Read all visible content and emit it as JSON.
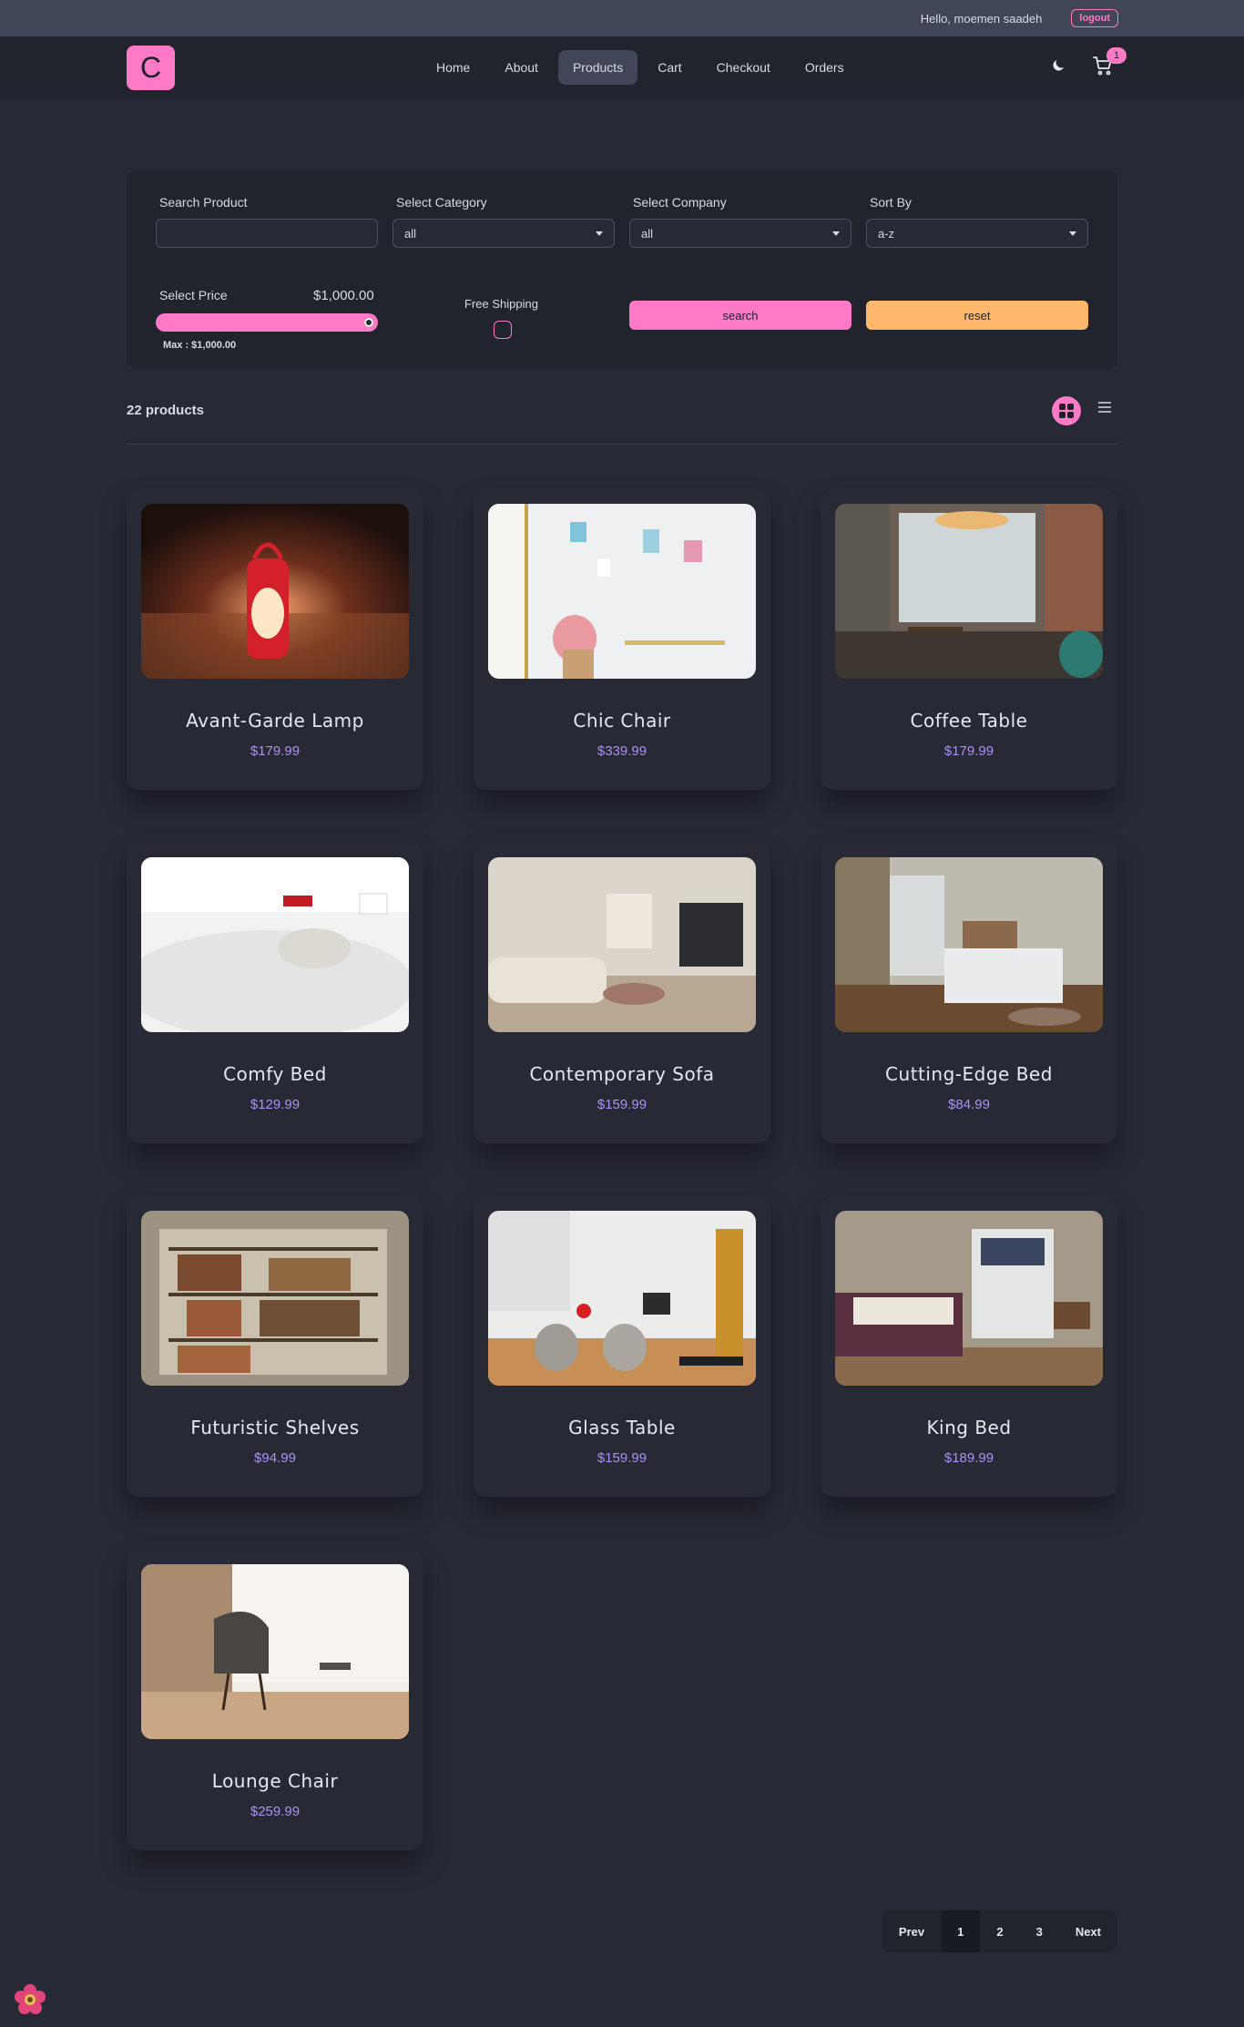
{
  "topbar": {
    "greeting": "Hello, moemen saadeh",
    "logout": "logout"
  },
  "nav": {
    "logo": "C",
    "links": [
      "Home",
      "About",
      "Products",
      "Cart",
      "Checkout",
      "Orders"
    ],
    "active": "Products",
    "cart_count": "1"
  },
  "filters": {
    "search_label": "Search Product",
    "search_value": "",
    "category_label": "Select Category",
    "category_value": "all",
    "company_label": "Select Company",
    "company_value": "all",
    "sort_label": "Sort By",
    "sort_value": "a-z",
    "price_label": "Select Price",
    "price_value": "$1,000.00",
    "price_max": "Max : $1,000.00",
    "price_level": 1.0,
    "shipping_label": "Free Shipping",
    "search_button": "search",
    "reset_button": "reset"
  },
  "results": {
    "count": "22 products"
  },
  "products": [
    {
      "title": "Avant-Garde Lamp",
      "price": "$179.99"
    },
    {
      "title": "Chic Chair",
      "price": "$339.99"
    },
    {
      "title": "Coffee Table",
      "price": "$179.99"
    },
    {
      "title": "Comfy Bed",
      "price": "$129.99"
    },
    {
      "title": "Contemporary Sofa",
      "price": "$159.99"
    },
    {
      "title": "Cutting-Edge Bed",
      "price": "$84.99"
    },
    {
      "title": "Futuristic Shelves",
      "price": "$94.99"
    },
    {
      "title": "Glass Table",
      "price": "$159.99"
    },
    {
      "title": "King Bed",
      "price": "$189.99"
    },
    {
      "title": "Lounge Chair",
      "price": "$259.99"
    }
  ],
  "pagination": {
    "prev": "Prev",
    "pages": [
      "1",
      "2",
      "3"
    ],
    "active": "1",
    "next": "Next"
  },
  "colors": {
    "primary": "#ff7ac6",
    "secondary": "#ffb86b",
    "price": "#a991f7",
    "bg": "#272935"
  }
}
